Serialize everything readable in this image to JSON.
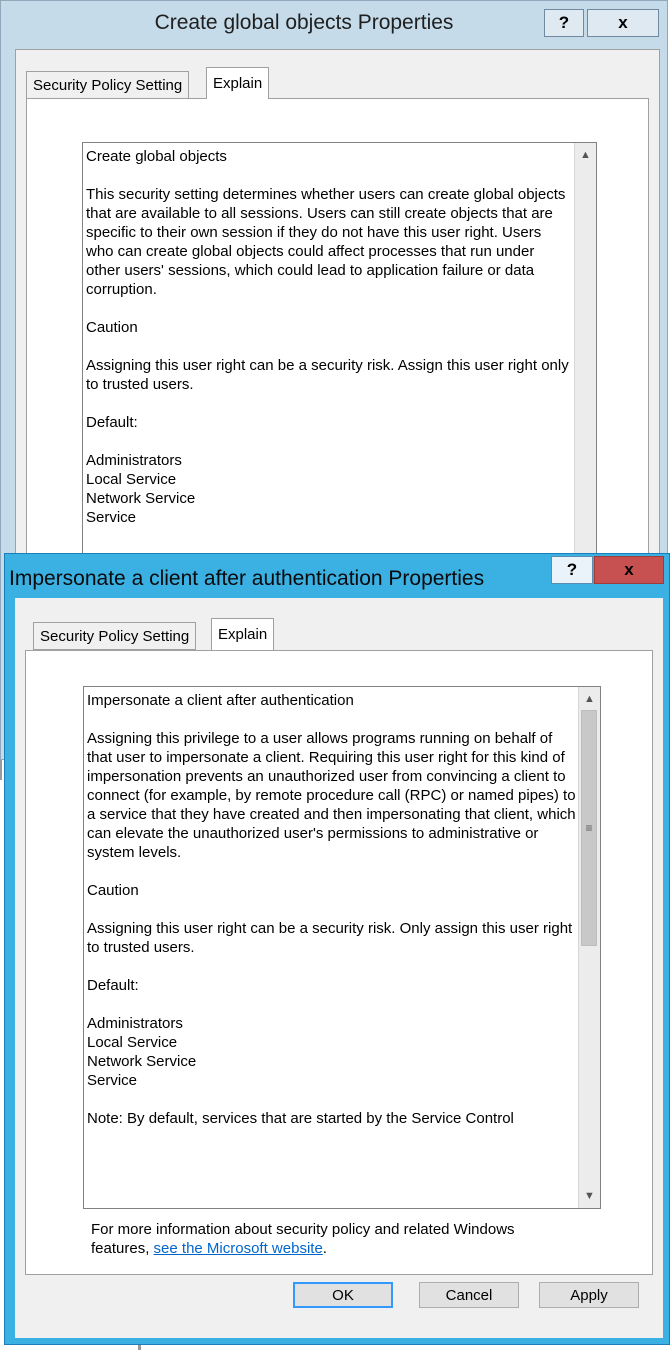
{
  "dialog_back": {
    "title": "Create global objects Properties",
    "help_label": "?",
    "close_label": "x",
    "tabs": [
      {
        "label": "Security Policy Setting"
      },
      {
        "label": "Explain"
      }
    ],
    "explain": {
      "heading": "Create global objects",
      "description": "This security setting determines whether users can create global objects that are available to all sessions. Users can still create objects that are specific to their own session if they do not have this user right. Users who can create global objects could affect processes that run under other users' sessions, which could lead to application failure or data corruption.",
      "caution_heading": "Caution",
      "caution_text": "Assigning this user right can be a security risk. Assign this user right only to trusted users.",
      "default_heading": "Default:",
      "defaults": [
        "Administrators",
        "Local Service",
        "Network Service",
        "Service"
      ]
    }
  },
  "dialog_front": {
    "title": "Impersonate a client after authentication Properties",
    "help_label": "?",
    "close_label": "x",
    "tabs": [
      {
        "label": "Security Policy Setting"
      },
      {
        "label": "Explain"
      }
    ],
    "explain": {
      "heading": "Impersonate a client after authentication",
      "description": "Assigning this privilege to a user allows programs running on behalf of that user to impersonate a client. Requiring this user right for this kind of impersonation prevents an unauthorized user from convincing a client to connect (for example, by remote procedure call (RPC) or named pipes) to a service that they have created and then impersonating that client, which can elevate the unauthorized user's permissions to administrative or system levels.",
      "caution_heading": "Caution",
      "caution_text": "Assigning this user right can be a security risk. Only assign this user right to trusted users.",
      "default_heading": "Default:",
      "defaults": [
        "Administrators",
        "Local Service",
        "Network Service",
        "Service"
      ],
      "note": "Note: By default, services that are started by the Service Control"
    },
    "info_text": "For more information about security policy and related Windows features, ",
    "info_link": "see the Microsoft website",
    "info_suffix": ".",
    "buttons": {
      "ok": "OK",
      "cancel": "Cancel",
      "apply": "Apply"
    }
  },
  "colors": {
    "active_frame": "#3ab0e3",
    "inactive_frame": "#c5dbe9",
    "close_button": "#c75050",
    "link": "#0066cc"
  },
  "icons": {
    "scroll_up": "▲",
    "scroll_down": "▼",
    "thumb_grip": "≡"
  }
}
